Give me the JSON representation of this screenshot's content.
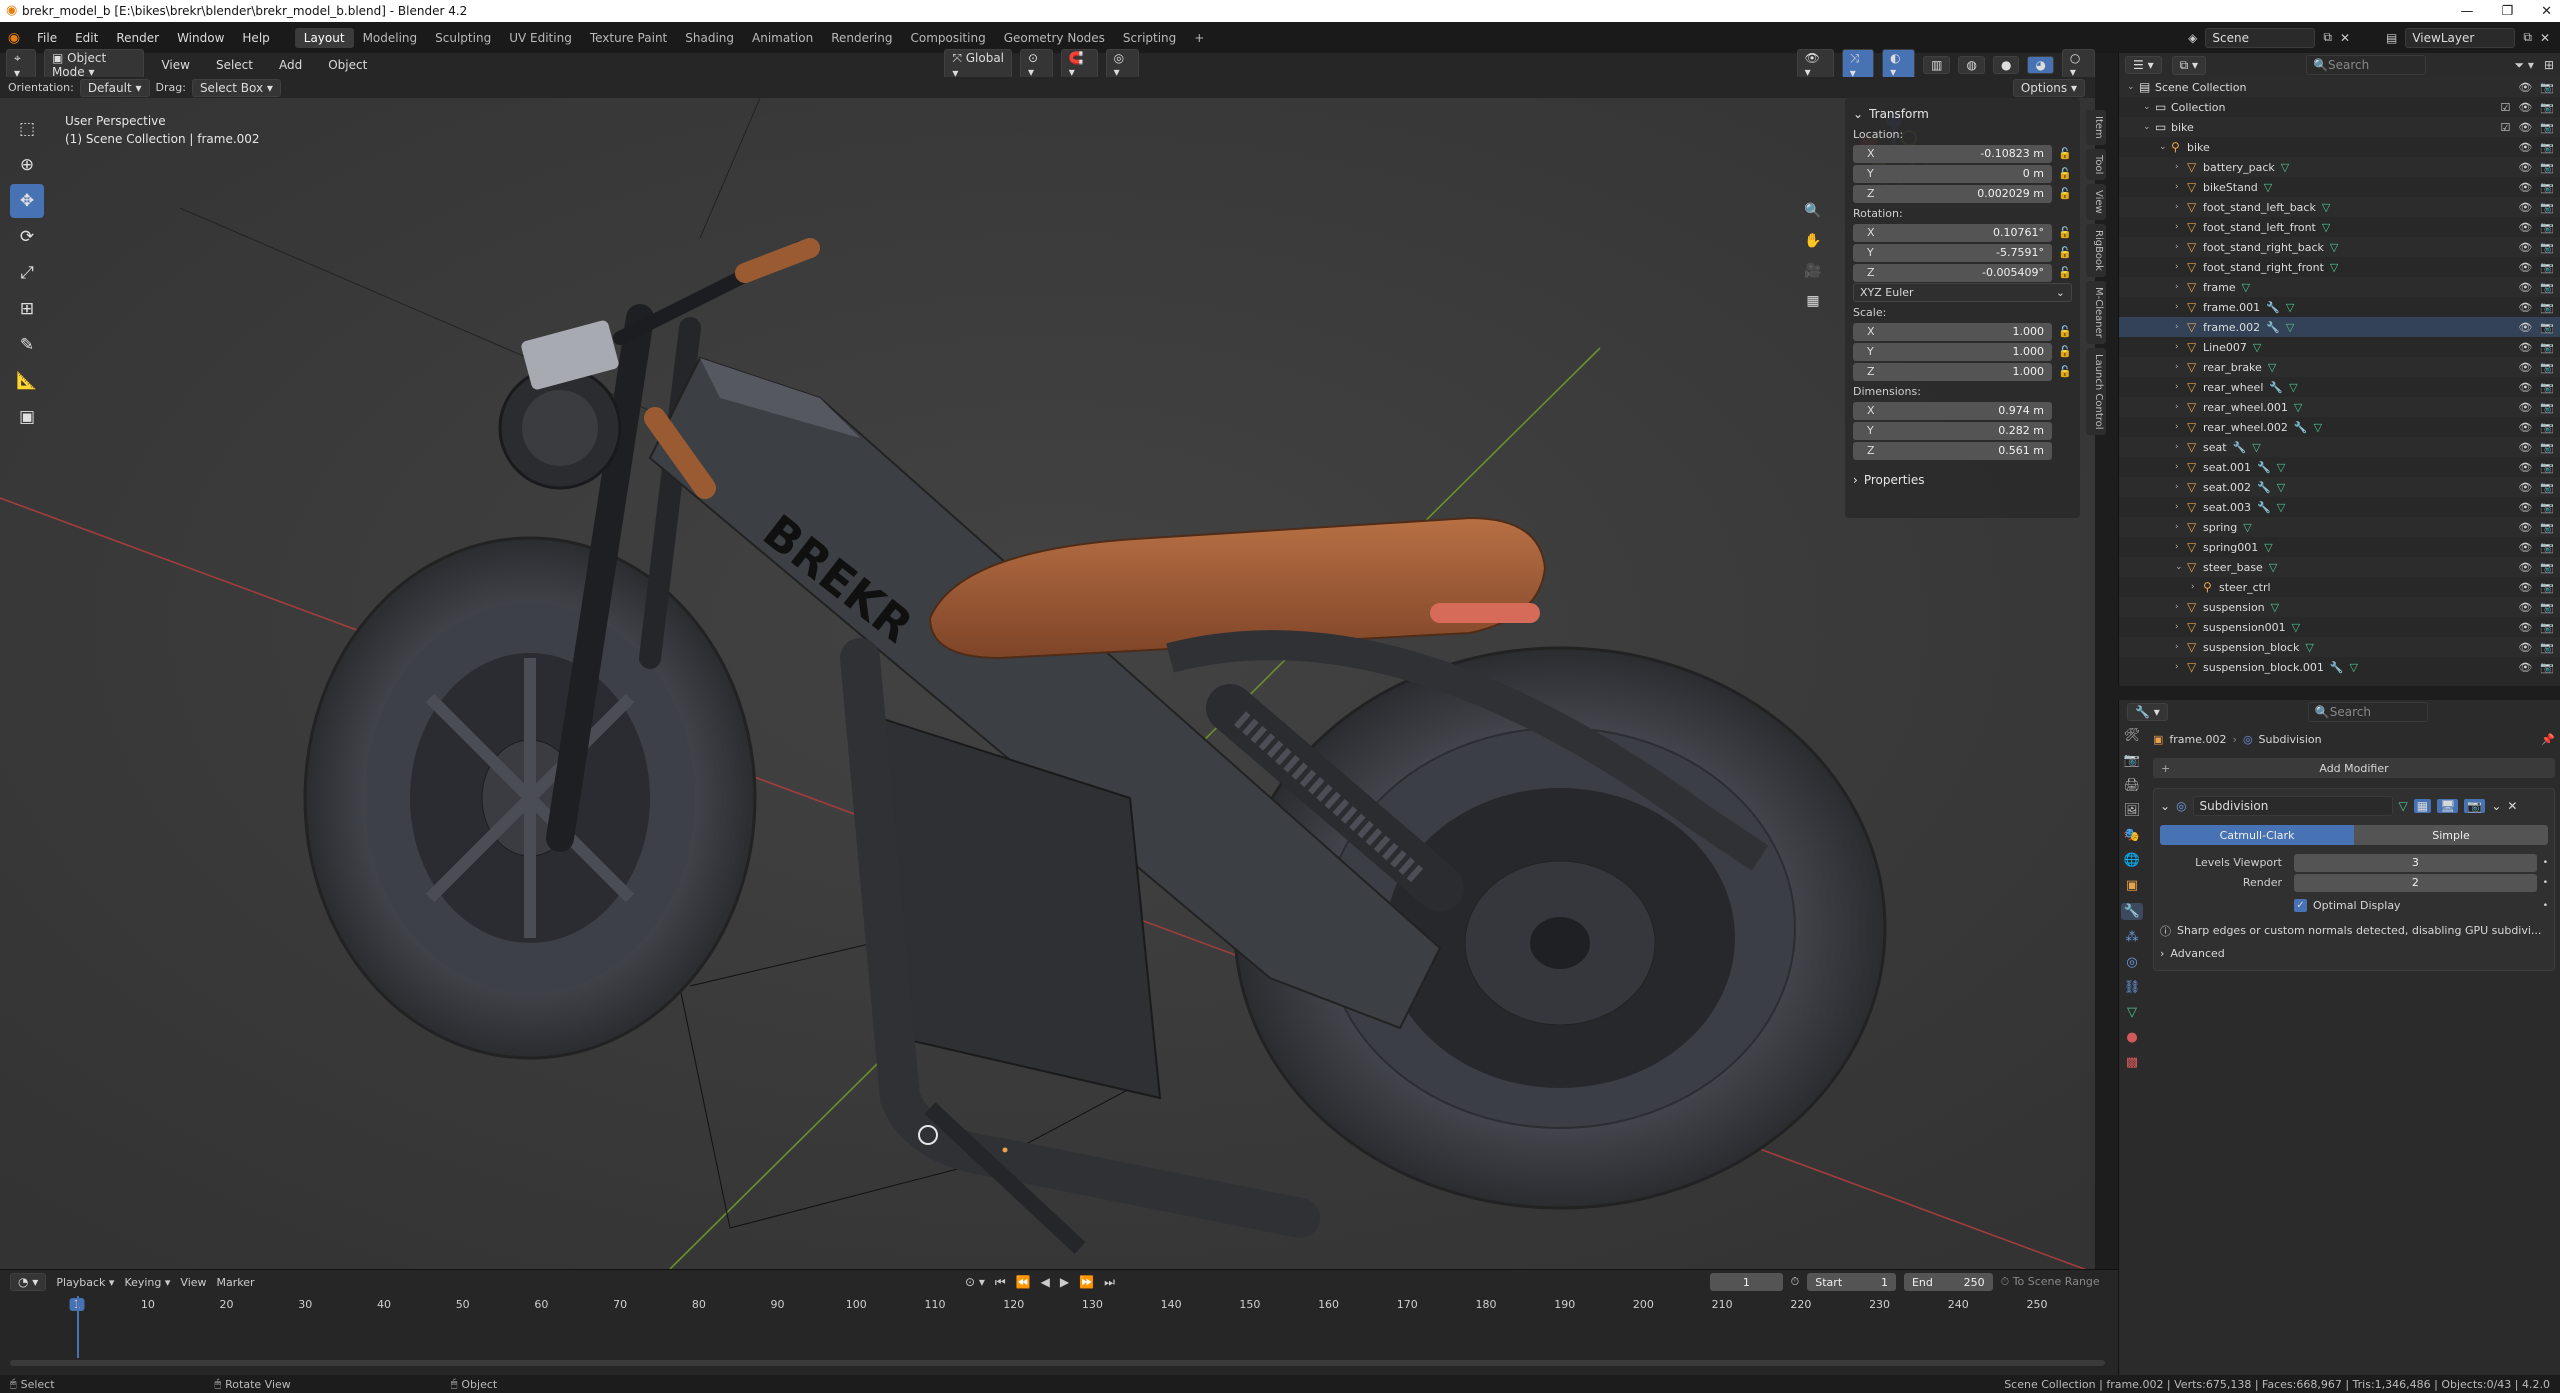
{
  "window": {
    "title": "brekr_model_b [E:\\bikes\\brekr\\blender\\brekr_model_b.blend] - Blender 4.2"
  },
  "menu": [
    "File",
    "Edit",
    "Render",
    "Window",
    "Help"
  ],
  "workspaces": [
    "Layout",
    "Modeling",
    "Sculpting",
    "UV Editing",
    "Texture Paint",
    "Shading",
    "Animation",
    "Rendering",
    "Compositing",
    "Geometry Nodes",
    "Scripting"
  ],
  "topright": {
    "scene": "Scene",
    "viewlayer": "ViewLayer"
  },
  "viewport_header": {
    "mode": "Object Mode",
    "menus": [
      "View",
      "Select",
      "Add",
      "Object"
    ],
    "transform_orientation": "Global",
    "orientation_label": "Orientation:",
    "orientation_value": "Default",
    "drag_label": "Drag:",
    "drag_value": "Select Box",
    "options": "Options"
  },
  "viewport": {
    "view_name": "User Perspective",
    "collection_path": "(1) Scene Collection | frame.002",
    "brand_text": "BREKR"
  },
  "transform": {
    "title": "Transform",
    "location_label": "Location:",
    "location": {
      "x": "-0.10823 m",
      "y": "0 m",
      "z": "0.002029 m"
    },
    "rotation_label": "Rotation:",
    "rotation": {
      "x": "0.10761°",
      "y": "-5.7591°",
      "z": "-0.005409°"
    },
    "rotation_mode": "XYZ Euler",
    "scale_label": "Scale:",
    "scale": {
      "x": "1.000",
      "y": "1.000",
      "z": "1.000"
    },
    "dimensions_label": "Dimensions:",
    "dimensions": {
      "x": "0.974 m",
      "y": "0.282 m",
      "z": "0.561 m"
    },
    "properties": "Properties"
  },
  "npanel_tabs": [
    "Item",
    "Tool",
    "View",
    "RigBook",
    "M-Cleaner",
    "Launch Control"
  ],
  "outliner": {
    "search_placeholder": "Search",
    "items": [
      {
        "name": "Scene Collection",
        "depth": 0,
        "kind": "scene"
      },
      {
        "name": "Collection",
        "depth": 1,
        "kind": "collection"
      },
      {
        "name": "bike",
        "depth": 1,
        "kind": "collection"
      },
      {
        "name": "bike",
        "depth": 2,
        "kind": "object"
      },
      {
        "name": "battery_pack",
        "depth": 3,
        "kind": "mesh"
      },
      {
        "name": "bikeStand",
        "depth": 3,
        "kind": "mesh"
      },
      {
        "name": "foot_stand_left_back",
        "depth": 3,
        "kind": "mesh"
      },
      {
        "name": "foot_stand_left_front",
        "depth": 3,
        "kind": "mesh"
      },
      {
        "name": "foot_stand_right_back",
        "depth": 3,
        "kind": "mesh"
      },
      {
        "name": "foot_stand_right_front",
        "depth": 3,
        "kind": "mesh"
      },
      {
        "name": "frame",
        "depth": 3,
        "kind": "mesh"
      },
      {
        "name": "frame.001",
        "depth": 3,
        "kind": "mesh-mod"
      },
      {
        "name": "frame.002",
        "depth": 3,
        "kind": "mesh-mod"
      },
      {
        "name": "Line007",
        "depth": 3,
        "kind": "mesh"
      },
      {
        "name": "rear_brake",
        "depth": 3,
        "kind": "mesh"
      },
      {
        "name": "rear_wheel",
        "depth": 3,
        "kind": "mesh-mod"
      },
      {
        "name": "rear_wheel.001",
        "depth": 3,
        "kind": "mesh"
      },
      {
        "name": "rear_wheel.002",
        "depth": 3,
        "kind": "mesh-mod"
      },
      {
        "name": "seat",
        "depth": 3,
        "kind": "mesh-mod"
      },
      {
        "name": "seat.001",
        "depth": 3,
        "kind": "mesh-mod"
      },
      {
        "name": "seat.002",
        "depth": 3,
        "kind": "mesh-mod"
      },
      {
        "name": "seat.003",
        "depth": 3,
        "kind": "mesh-mod"
      },
      {
        "name": "spring",
        "depth": 3,
        "kind": "mesh"
      },
      {
        "name": "spring001",
        "depth": 3,
        "kind": "mesh"
      },
      {
        "name": "steer_base",
        "depth": 3,
        "kind": "mesh"
      },
      {
        "name": "steer_ctrl",
        "depth": 4,
        "kind": "object"
      },
      {
        "name": "suspension",
        "depth": 3,
        "kind": "mesh"
      },
      {
        "name": "suspension001",
        "depth": 3,
        "kind": "mesh"
      },
      {
        "name": "suspension_block",
        "depth": 3,
        "kind": "mesh"
      },
      {
        "name": "suspension_block.001",
        "depth": 3,
        "kind": "mesh-mod"
      }
    ]
  },
  "properties": {
    "search_placeholder": "Search",
    "breadcrumb_object": "frame.002",
    "breadcrumb_modifier": "Subdivision",
    "add_modifier": "Add Modifier",
    "modifier_name": "Subdivision",
    "algo_options": [
      "Catmull-Clark",
      "Simple"
    ],
    "levels_viewport_label": "Levels Viewport",
    "levels_viewport": "3",
    "render_label": "Render",
    "render": "2",
    "optimal_display": "Optimal Display",
    "warning": "Sharp edges or custom normals detected, disabling GPU subdivi...",
    "advanced": "Advanced"
  },
  "timeline": {
    "menus": [
      "Playback",
      "Keying",
      "View",
      "Marker"
    ],
    "current_frame": "1",
    "start_label": "Start",
    "start": "1",
    "end_label": "End",
    "end": "250",
    "to_scene_range": "To Scene Range",
    "ruler": [
      "1",
      "10",
      "20",
      "30",
      "40",
      "50",
      "60",
      "70",
      "80",
      "90",
      "100",
      "110",
      "120",
      "130",
      "140",
      "150",
      "160",
      "170",
      "180",
      "190",
      "200",
      "210",
      "220",
      "230",
      "240",
      "250"
    ]
  },
  "statusbar": {
    "select": "Select",
    "rotate": "Rotate View",
    "object": "Object",
    "stats": "Scene Collection | frame.002 | Verts:675,138 | Faces:668,967 | Tris:1,346,486 | Objects:0/43 | 4.2.0"
  },
  "colors": {
    "accent": "#4772b3",
    "object_orange": "#e8a34a",
    "mesh_green": "#4fc48f"
  }
}
